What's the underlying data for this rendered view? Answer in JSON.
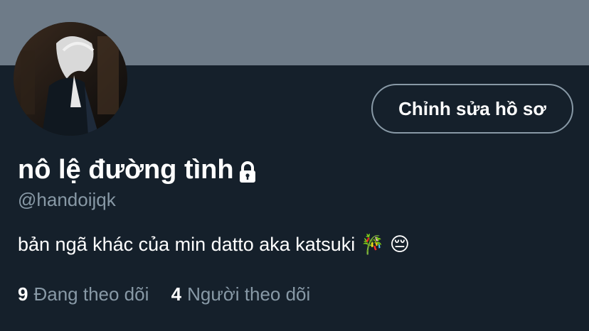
{
  "profile": {
    "display_name": "nô lệ đường tình",
    "handle": "@handoijqk",
    "bio": "bản ngã khác của min datto aka katsuki 🎋 😔",
    "edit_button_label": "Chỉnh sửa hồ sơ",
    "protected_icon": "lock-icon"
  },
  "stats": {
    "following_count": "9",
    "following_label": "Đang theo dõi",
    "followers_count": "4",
    "followers_label": "Người theo dõi"
  },
  "colors": {
    "background": "#15202b",
    "banner": "#6e7b88",
    "secondary_text": "#8899a6"
  }
}
